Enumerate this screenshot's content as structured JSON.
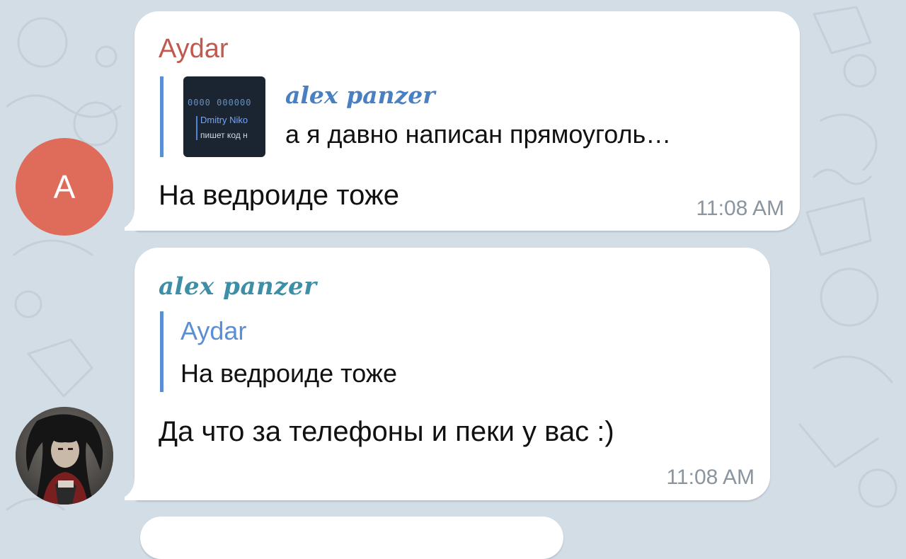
{
  "colors": {
    "background": "#d3dde6",
    "bubble": "#ffffff",
    "aydar_name": "#c05a4f",
    "alex_name_bubble": "#3e8fa6",
    "alex_name_reply": "#4a7fc1",
    "reply_bar": "#5b8fd3",
    "avatar_a": "#df6c5a",
    "timestamp": "#8a959f"
  },
  "messages": [
    {
      "avatar": {
        "letter": "A",
        "icon": "letter-avatar"
      },
      "sender": "Aydar",
      "reply": {
        "title": "alex panzer",
        "text": "а я давно написан прямоуголь…",
        "thumbnail": {
          "icon": "code-screenshot-thumbnail",
          "line1": "0000 000000",
          "line2": "Dmitry Niko",
          "line3": "пишет код н"
        }
      },
      "text": "На ведроиде тоже",
      "time": "11:08 AM"
    },
    {
      "avatar": {
        "icon": "profile-photo-avatar"
      },
      "sender": "alex panzer",
      "reply": {
        "title": "Aydar",
        "text": "На ведроиде тоже"
      },
      "text": "Да что за телефоны и пеки у вас :)",
      "time": "11:08 AM"
    }
  ]
}
